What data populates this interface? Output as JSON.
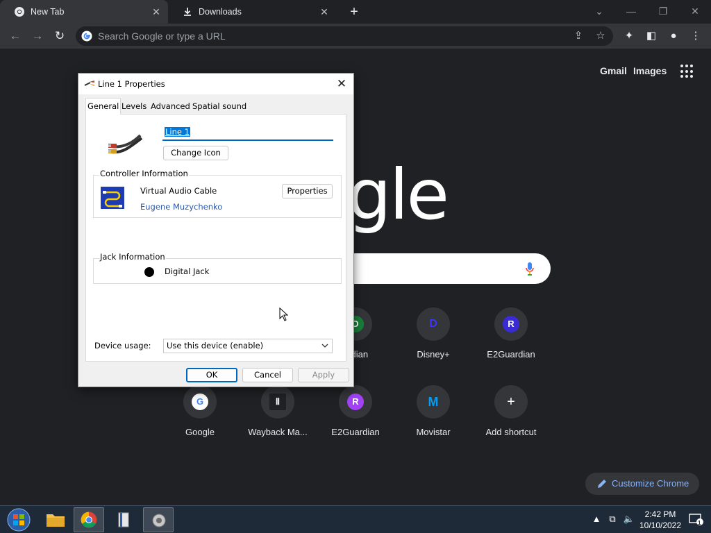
{
  "browser": {
    "tabs": [
      {
        "label": "New Tab",
        "icon": "chrome-icon",
        "active": true
      },
      {
        "label": "Downloads",
        "icon": "download-icon",
        "active": false
      }
    ],
    "omnibox_placeholder": "Search Google or type a URL"
  },
  "ntp": {
    "gmail": "Gmail",
    "images": "Images",
    "logo_partial": "ogle",
    "shortcuts_row1": [
      {
        "label": "ardian",
        "letter": "D",
        "color": "#188038"
      },
      {
        "label": "Disney+",
        "letter": "D",
        "color": "#3d35ff"
      },
      {
        "label": "E2Guardian",
        "letter": "R",
        "color": "#3b2bd6"
      }
    ],
    "shortcuts_row2": [
      {
        "label": "Google",
        "letter": "G",
        "color": "#ffffff"
      },
      {
        "label": "Wayback Ma...",
        "letter": "Ⅱ",
        "color": "#202124"
      },
      {
        "label": "E2Guardian",
        "letter": "R",
        "color": "#a142f4"
      },
      {
        "label": "Movistar",
        "letter": "M",
        "color": "#019df4"
      },
      {
        "label": "Add shortcut",
        "letter": "+",
        "color": "#35363a"
      }
    ],
    "customize_label": "Customize Chrome"
  },
  "dialog": {
    "title": "Line 1 Properties",
    "tabs": [
      "General",
      "Levels",
      "Advanced",
      "Spatial sound"
    ],
    "device_name": "Line 1",
    "change_icon_label": "Change Icon",
    "controller": {
      "group_label": "Controller Information",
      "name": "Virtual Audio Cable",
      "vendor": "Eugene Muzychenko",
      "properties_label": "Properties"
    },
    "jack": {
      "group_label": "Jack Information",
      "name": "Digital Jack"
    },
    "device_usage_label": "Device usage:",
    "device_usage_value": "Use this device (enable)",
    "ok_label": "OK",
    "cancel_label": "Cancel",
    "apply_label": "Apply"
  },
  "taskbar": {
    "time": "2:42 PM",
    "date": "10/10/2022",
    "notification_count": "1"
  }
}
